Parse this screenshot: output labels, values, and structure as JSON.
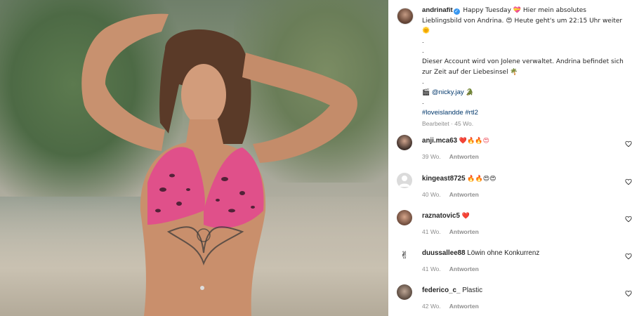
{
  "post": {
    "author": "andrinafit",
    "caption_text": "Happy Tuesday 💝 Hier mein absolutes Lieblingsbild von Andrina. 😍 Heute geht's um 22:15 Uhr weiter 🌞",
    "dot1": ".",
    "dot2": ".",
    "paragraph2": "Dieser Account wird von Jolene verwaltet. Andrina befindet sich zur Zeit auf der Liebesinsel 🌴",
    "dot3": ".",
    "credit_prefix": "🎬",
    "credit_handle": "@nicky.jay",
    "credit_suffix": "🐊",
    "dot4": ".",
    "hashtags": "#loveislandde #rtl2",
    "edited": "Bearbeitet · 45 Wo."
  },
  "comments": [
    {
      "user": "anji.mca63",
      "text": "",
      "emoji": "❤️🔥🔥😍",
      "age": "39 Wo.",
      "reply": "Antworten"
    },
    {
      "user": "kingeast8725",
      "text": "",
      "emoji": "🔥🔥😍😍",
      "age": "40 Wo.",
      "reply": "Antworten"
    },
    {
      "user": "raznatovic5",
      "text": "",
      "emoji": "❤️",
      "age": "41 Wo.",
      "reply": "Antworten"
    },
    {
      "user": "duussallee88",
      "text": "Löwin ohne Konkurrenz",
      "emoji": "",
      "age": "41 Wo.",
      "reply": "Antworten"
    },
    {
      "user": "federico_c_",
      "text": "Plastic",
      "emoji": "",
      "age": "42 Wo.",
      "reply": "Antworten"
    }
  ],
  "icons": {
    "like": "heart-outline-icon",
    "verified": "verified-badge-icon"
  }
}
